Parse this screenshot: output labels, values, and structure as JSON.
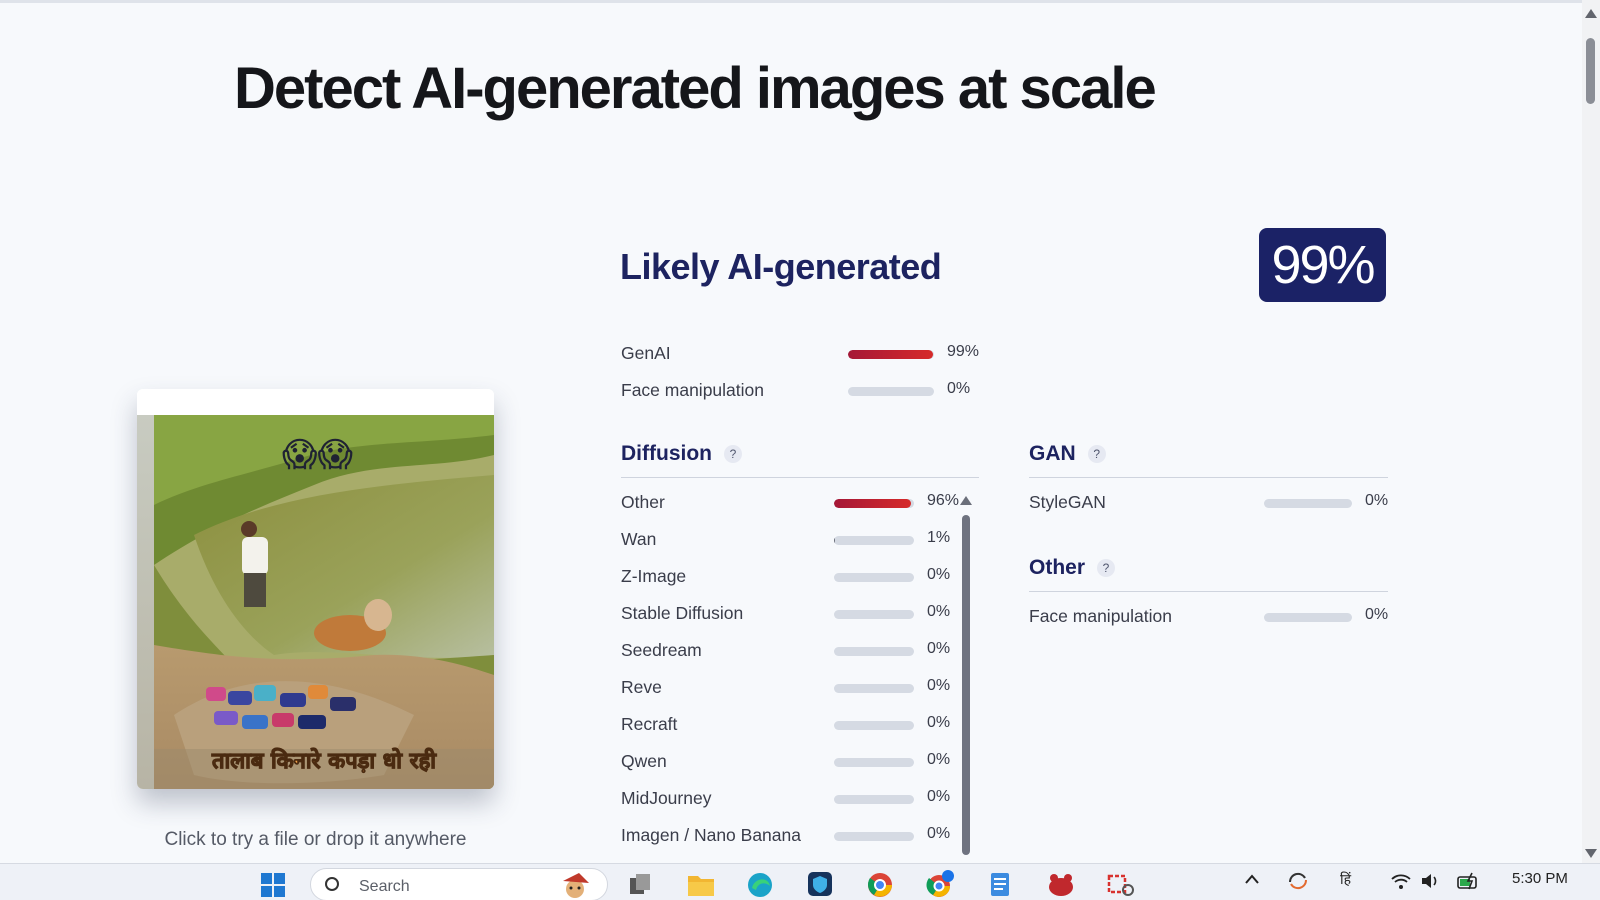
{
  "hero": {
    "title": "Detect AI-generated images at scale"
  },
  "upload": {
    "drop_hint": "Click to try a file or drop it anywhere",
    "caption_line1": "तालाब किनारे कपड़ा धो रही",
    "emoji": "😱😱"
  },
  "result": {
    "verdict": "Likely AI-generated",
    "score": "99%",
    "summary": [
      {
        "label": "GenAI",
        "value": 99,
        "pct_label": "99%"
      },
      {
        "label": "Face manipulation",
        "value": 0,
        "pct_label": "0%"
      }
    ]
  },
  "diffusion": {
    "title": "Diffusion",
    "help": "?",
    "items": [
      {
        "label": "Other",
        "value": 96,
        "pct_label": "96%"
      },
      {
        "label": "Wan",
        "value": 1,
        "pct_label": "1%"
      },
      {
        "label": "Z-Image",
        "value": 0,
        "pct_label": "0%"
      },
      {
        "label": "Stable Diffusion",
        "value": 0,
        "pct_label": "0%"
      },
      {
        "label": "Seedream",
        "value": 0,
        "pct_label": "0%"
      },
      {
        "label": "Reve",
        "value": 0,
        "pct_label": "0%"
      },
      {
        "label": "Recraft",
        "value": 0,
        "pct_label": "0%"
      },
      {
        "label": "Qwen",
        "value": 0,
        "pct_label": "0%"
      },
      {
        "label": "MidJourney",
        "value": 0,
        "pct_label": "0%"
      },
      {
        "label": "Imagen / Nano Banana",
        "value": 0,
        "pct_label": "0%"
      }
    ]
  },
  "gan": {
    "title": "GAN",
    "help": "?",
    "items": [
      {
        "label": "StyleGAN",
        "value": 0,
        "pct_label": "0%"
      }
    ]
  },
  "other": {
    "title": "Other",
    "help": "?",
    "items": [
      {
        "label": "Face manipulation",
        "value": 0,
        "pct_label": "0%"
      }
    ]
  },
  "colors": {
    "accent": "#1b2266",
    "bar_fill": "#c4202f",
    "bar_track": "#d5dae3"
  },
  "taskbar": {
    "search_placeholder": "Search",
    "apps": [
      "windows-start",
      "task-view",
      "file-explorer",
      "edge",
      "security-app",
      "chrome-canary",
      "chrome-profile",
      "notepad",
      "game-app",
      "snipping-tool"
    ],
    "tray": {
      "language": "हिं",
      "time": "5:30 PM"
    }
  }
}
